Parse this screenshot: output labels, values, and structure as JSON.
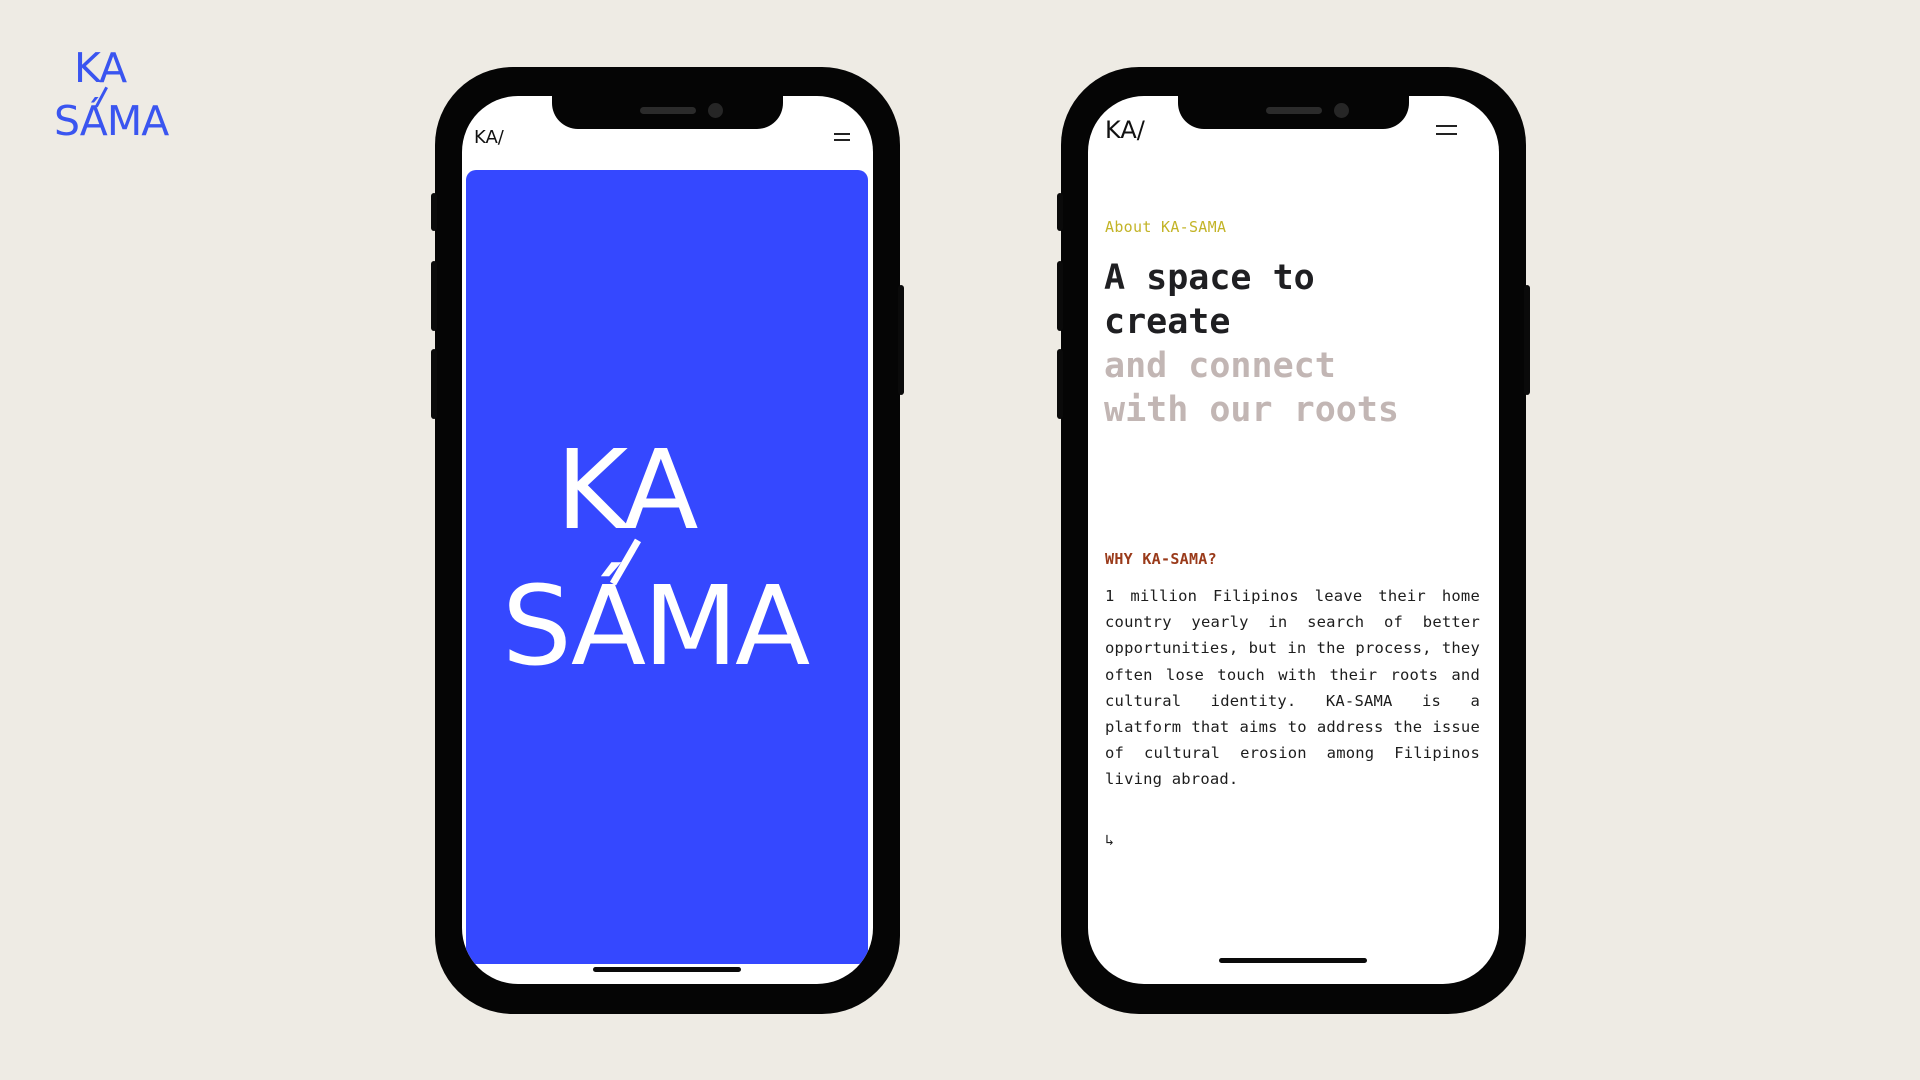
{
  "brand": {
    "logo_line1": "KA",
    "logo_line2": "SÁMA",
    "brand_mark": "KA/"
  },
  "colors": {
    "background": "#eeebe4",
    "logo_blue": "#3a55f0",
    "splash_blue": "#3548ff",
    "eyebrow_yellow": "#c3b428",
    "heading_dark": "#1f1f22",
    "heading_muted": "#c2b6b4",
    "accent_rust": "#9a3a1a"
  },
  "phone_left": {
    "menu_icon": "hamburger-icon",
    "splash": {
      "line1": "KA",
      "line2": "SÁMA"
    }
  },
  "phone_right": {
    "menu_icon": "hamburger-icon",
    "eyebrow": "About KA-SAMA",
    "headline": {
      "line1": "A space to",
      "line2": "create",
      "line3": "and connect",
      "line4": "with our roots"
    },
    "why_title": "WHY KA-SAMA?",
    "body": "1 million Filipinos leave their home country yearly in search of better opportunities, but in the process, they often lose touch with their roots and cultural identity. KA-SAMA is a platform that aims to address the issue of cultural erosion among Filipinos living abroad.",
    "arrow_glyph": "↳",
    "arrow_icon": "return-arrow-icon"
  }
}
